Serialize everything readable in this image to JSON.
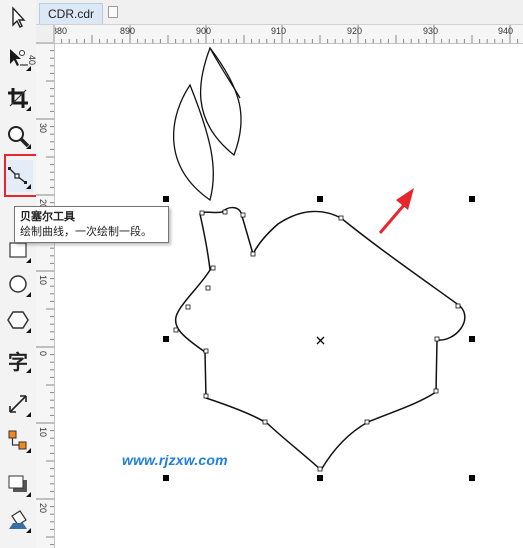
{
  "document": {
    "tab_title": "CDR.cdr"
  },
  "toolbox": {
    "tools": [
      {
        "name": "pick-tool"
      },
      {
        "name": "shape-tool"
      },
      {
        "name": "crop-tool"
      },
      {
        "name": "zoom-tool"
      },
      {
        "name": "bezier-tool",
        "active": true
      },
      {
        "name": "rectangle-tool"
      },
      {
        "name": "ellipse-tool"
      },
      {
        "name": "polygon-tool"
      },
      {
        "name": "text-tool",
        "glyph": "字"
      },
      {
        "name": "dimension-tool"
      },
      {
        "name": "connector-tool"
      },
      {
        "name": "drop-shadow-tool"
      },
      {
        "name": "fill-tool"
      }
    ]
  },
  "tooltip": {
    "title": "贝塞尔工具",
    "description": "绘制曲线，一次绘制一段。"
  },
  "rulers": {
    "horizontal_labels": [
      "880",
      "890",
      "900",
      "910",
      "920",
      "930",
      "940"
    ],
    "vertical_labels": [
      "40",
      "30",
      "20",
      "10",
      "0",
      "10",
      "20"
    ]
  },
  "watermark": "www.rjzxw.com",
  "colors": {
    "highlight": "#e8262d",
    "arrow": "#e8262d",
    "watermark": "#1f7ee0"
  }
}
